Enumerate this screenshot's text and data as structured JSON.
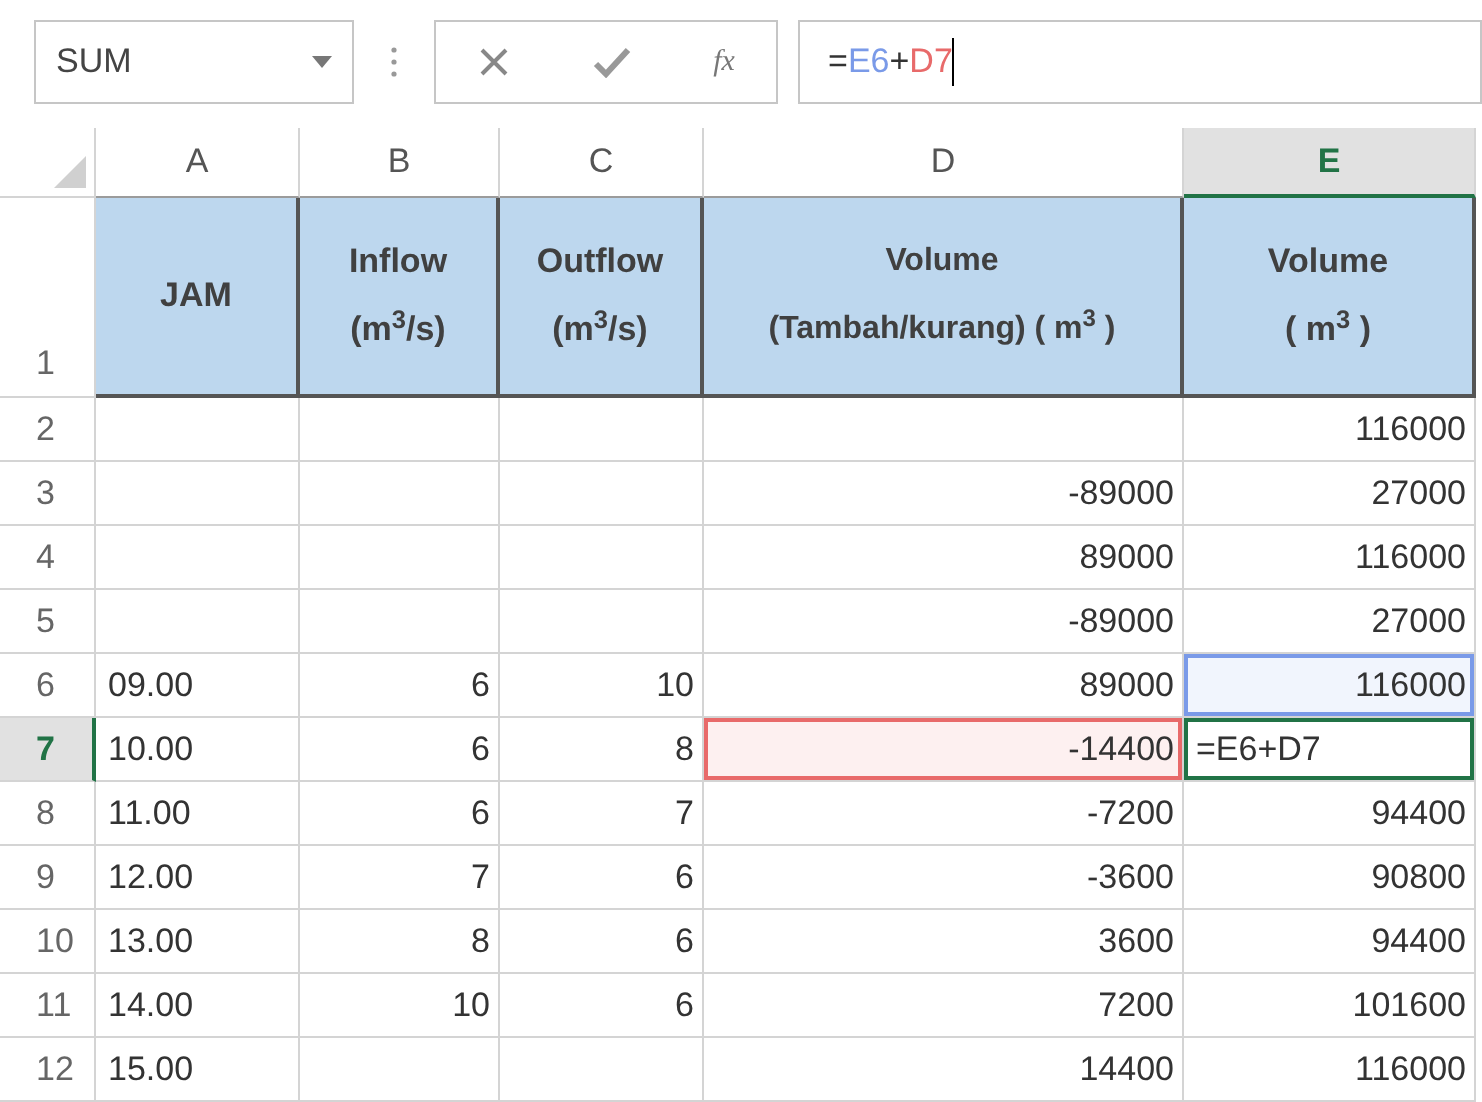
{
  "name_box": {
    "value": "SUM"
  },
  "formula_bar": {
    "parts": [
      {
        "text": "=",
        "color": "#333333"
      },
      {
        "text": "E6",
        "color": "#7a9ae8"
      },
      {
        "text": "+",
        "color": "#333333"
      },
      {
        "text": "D7",
        "color": "#e86a6a"
      }
    ]
  },
  "fx_label": "fx",
  "columns": [
    {
      "label": "A",
      "selected": false
    },
    {
      "label": "B",
      "selected": false
    },
    {
      "label": "C",
      "selected": false
    },
    {
      "label": "D",
      "selected": false
    },
    {
      "label": "E",
      "selected": true
    }
  ],
  "header_row": {
    "num": "1",
    "selected": false,
    "cells": [
      "JAM",
      "Inflow\n(m$^{3}$/s)",
      "Outflow\n(m$^{3}$/s)",
      "Volume\n(Tambah/kurang) ( m$^{3}$ )",
      "Volume\n( m$^{3}$ )"
    ]
  },
  "rows": [
    {
      "num": "2",
      "selected": false,
      "cells": [
        {},
        {},
        {},
        {},
        {
          "text": "116000"
        }
      ]
    },
    {
      "num": "3",
      "selected": false,
      "cells": [
        {},
        {},
        {},
        {
          "text": "-89000"
        },
        {
          "text": "27000"
        }
      ]
    },
    {
      "num": "4",
      "selected": false,
      "cells": [
        {},
        {},
        {},
        {
          "text": "89000"
        },
        {
          "text": "116000"
        }
      ]
    },
    {
      "num": "5",
      "selected": false,
      "cells": [
        {},
        {},
        {},
        {
          "text": "-89000"
        },
        {
          "text": "27000"
        }
      ]
    },
    {
      "num": "6",
      "selected": false,
      "cells": [
        {
          "text": "09.00"
        },
        {
          "text": "6"
        },
        {
          "text": "10"
        },
        {
          "text": "89000"
        },
        {
          "text": "116000",
          "color": "#7a9ae8"
        }
      ]
    },
    {
      "num": "7",
      "selected": true,
      "cells": [
        {
          "text": "10.00"
        },
        {
          "text": "6"
        },
        {
          "text": "8"
        },
        {
          "text": "-14400",
          "color": "#e86a6a"
        },
        {
          "text": "=E6+D7",
          "editing": true
        }
      ]
    },
    {
      "num": "8",
      "selected": false,
      "cells": [
        {
          "text": "11.00"
        },
        {
          "text": "6"
        },
        {
          "text": "7"
        },
        {
          "text": "-7200"
        },
        {
          "text": "94400"
        }
      ]
    },
    {
      "num": "9",
      "selected": false,
      "cells": [
        {
          "text": "12.00"
        },
        {
          "text": "7"
        },
        {
          "text": "6"
        },
        {
          "text": "-3600"
        },
        {
          "text": "90800"
        }
      ]
    },
    {
      "num": "10",
      "selected": false,
      "cells": [
        {
          "text": "13.00"
        },
        {
          "text": "8"
        },
        {
          "text": "6"
        },
        {
          "text": "3600"
        },
        {
          "text": "94400"
        }
      ]
    },
    {
      "num": "11",
      "selected": false,
      "cells": [
        {
          "text": "14.00"
        },
        {
          "text": "10"
        },
        {
          "text": "6"
        },
        {
          "text": "7200"
        },
        {
          "text": "101600"
        }
      ]
    },
    {
      "num": "12",
      "selected": false,
      "cells": [
        {
          "text": "15.00"
        },
        {},
        {},
        {
          "text": "14400"
        },
        {
          "text": "116000"
        }
      ]
    }
  ]
}
